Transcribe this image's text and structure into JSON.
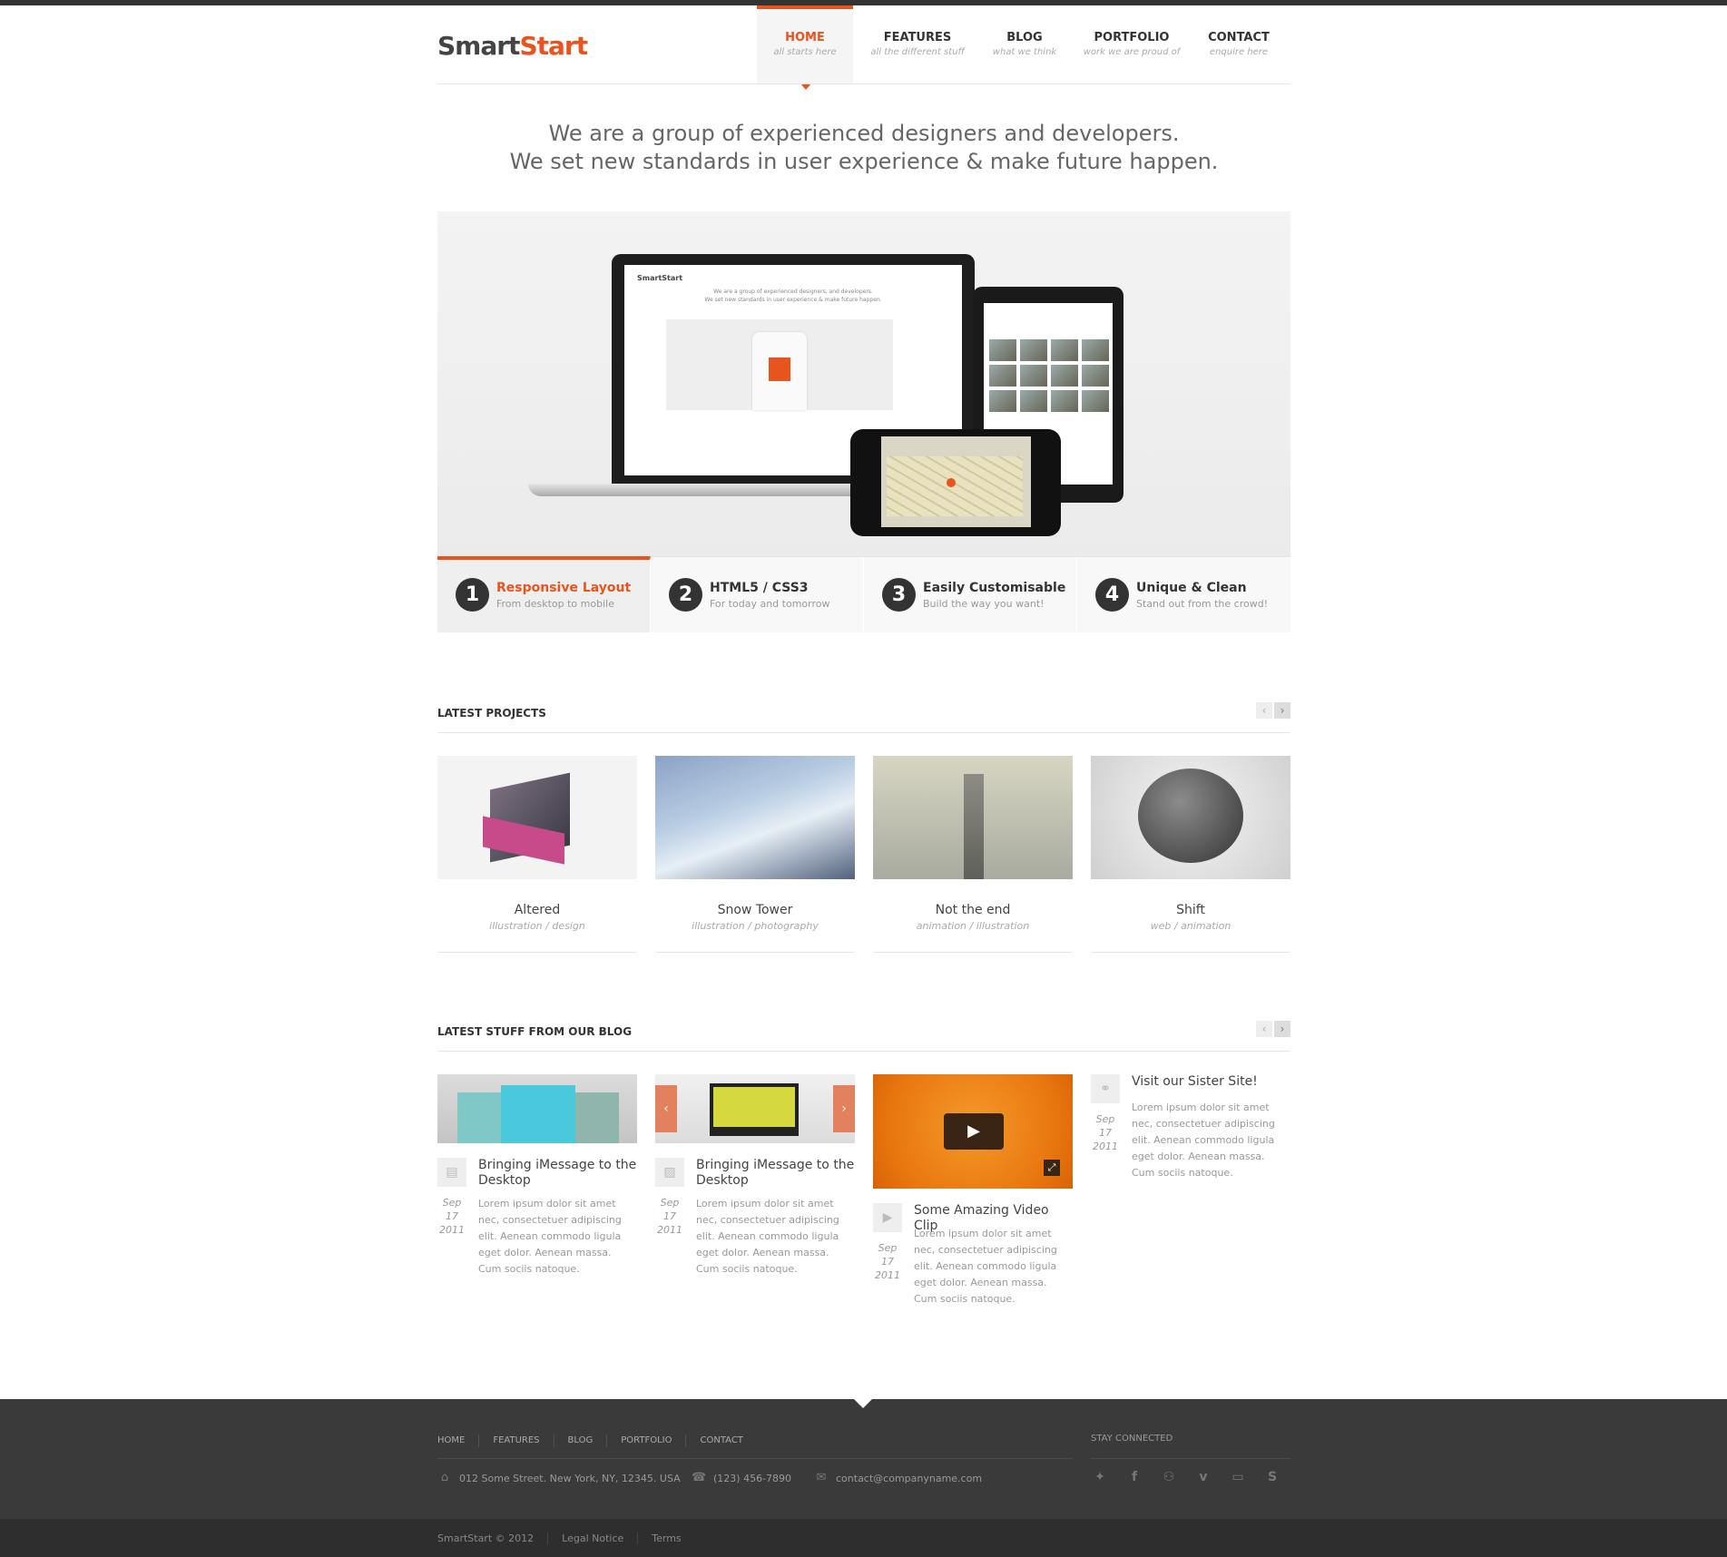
{
  "brand": {
    "logo_part1": "Smart",
    "logo_part2": "Start",
    "accent": "#e8541e"
  },
  "nav": [
    {
      "label": "HOME",
      "sub": "all starts here",
      "active": true
    },
    {
      "label": "FEATURES",
      "sub": "all the different stuff"
    },
    {
      "label": "BLOG",
      "sub": "what we think"
    },
    {
      "label": "PORTFOLIO",
      "sub": "work we are proud of"
    },
    {
      "label": "CONTACT",
      "sub": "enquire here"
    }
  ],
  "intro": {
    "line1": "We are a group of experienced designers and developers.",
    "line2": "We set new standards in user experience & make future happen."
  },
  "slider": {
    "mini_logo": "SmartStart",
    "mini_line1": "We are a group of experienced designers, and developers.",
    "mini_line2": "We set new standards in user experience & make future happen."
  },
  "features": [
    {
      "num": "1",
      "title": "Responsive Layout",
      "sub": "From desktop to mobile",
      "active": true
    },
    {
      "num": "2",
      "title": "HTML5 / CSS3",
      "sub": "For today and tomorrow"
    },
    {
      "num": "3",
      "title": "Easily Customisable",
      "sub": "Build the way you want!"
    },
    {
      "num": "4",
      "title": "Unique & Clean",
      "sub": "Stand out from the crowd!"
    }
  ],
  "projects_section": {
    "title": "LATEST PROJECTS",
    "prev": "‹",
    "next": "›"
  },
  "projects": [
    {
      "title": "Altered",
      "tags": "illustration / design"
    },
    {
      "title": "Snow Tower",
      "tags": "illustration / photography"
    },
    {
      "title": "Not the end",
      "tags": "animation / illustration"
    },
    {
      "title": "Shift",
      "tags": "web / animation"
    }
  ],
  "blog_section": {
    "title": "LATEST STUFF FROM OUR BLOG",
    "prev": "‹",
    "next": "›"
  },
  "posts": [
    {
      "title": "Bringing iMessage to the Desktop",
      "date1": "Sep 17",
      "date2": "2011",
      "text": "Lorem ipsum dolor sit amet nec, consectetuer adipiscing elit. Aenean commodo ligula eget dolor. Aenean massa. Cum sociis natoque.",
      "icon": "document-icon"
    },
    {
      "title": "Bringing iMessage to the Desktop",
      "date1": "Sep 17",
      "date2": "2011",
      "text": "Lorem ipsum dolor sit amet nec, consectetuer adipiscing elit. Aenean commodo ligula eget dolor. Aenean massa. Cum sociis natoque.",
      "icon": "gallery-icon"
    },
    {
      "title": "Some Amazing Video Clip",
      "date1": "Sep 17",
      "date2": "2011",
      "text": "Lorem ipsum dolor sit amet nec, consectetuer adipiscing elit. Aenean commodo ligula eget dolor. Aenean massa. Cum sociis natoque.",
      "icon": "video-icon"
    },
    {
      "title": "Visit our Sister Site!",
      "date1": "Sep 17",
      "date2": "2011",
      "text": "Lorem ipsum dolor sit amet nec, consectetuer adipiscing elit. Aenean commodo ligula eget dolor. Aenean massa. Cum sociis natoque.",
      "icon": "link-icon"
    }
  ],
  "footer": {
    "nav": [
      "HOME",
      "FEATURES",
      "BLOG",
      "PORTFOLIO",
      "CONTACT"
    ],
    "address": "012 Some Street. New York, NY, 12345. USA",
    "phone": "(123) 456-7890",
    "email": "contact@companyname.com",
    "stay_connected": "STAY CONNECTED",
    "social": [
      "twitter-icon",
      "facebook-icon",
      "myspace-icon",
      "vimeo-icon",
      "youtube-icon",
      "skype-icon"
    ],
    "copyright": "SmartStart © 2012",
    "legal": "Legal Notice",
    "terms": "Terms"
  }
}
